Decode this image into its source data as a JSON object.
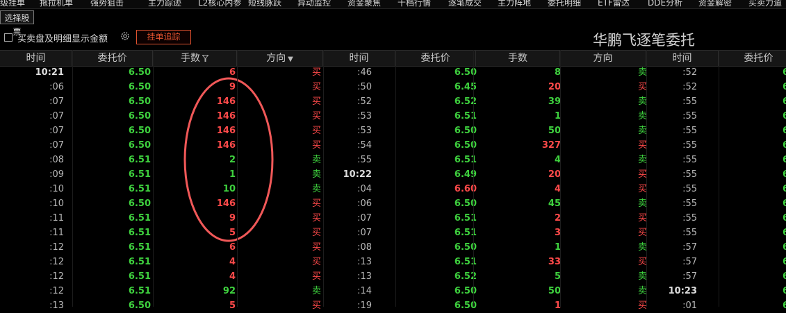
{
  "nav": {
    "tabs": [
      "级挂单",
      "拖拉机单",
      "强势狙击",
      "主力踪迹",
      "L2核心内参",
      "短线脉跃",
      "异动监控",
      "资金聚焦",
      "千档行情",
      "逐笔成交",
      "主力阵地",
      "委托明细",
      "ETF雷达",
      "DDE分析",
      "资金解密",
      "买卖力道"
    ]
  },
  "toolbar": {
    "select_stock_label": "选择股票",
    "show_amount_label": "买卖盘及明细显示金额",
    "show_amount_checked": false,
    "trace_label": "挂单追踪"
  },
  "panel_title": "华鹏飞逐笔委托",
  "columns": {
    "time": "时间",
    "price": "委托价",
    "qty": "手数",
    "dir": "方向"
  },
  "colors": {
    "up": "#ff4a4a",
    "down": "#3ed13e",
    "accent": "#e0522f",
    "annotation": "#ff5a5a"
  },
  "groups": [
    {
      "rows": [
        {
          "t": "10:21",
          "p": "6.50",
          "pc": "green",
          "q": "6",
          "d": "买"
        },
        {
          "t": ":06",
          "p": "6.50",
          "pc": "green",
          "q": "9",
          "d": "买"
        },
        {
          "t": ":07",
          "p": "6.50",
          "pc": "green",
          "q": "146",
          "d": "买"
        },
        {
          "t": ":07",
          "p": "6.50",
          "pc": "green",
          "q": "146",
          "d": "买"
        },
        {
          "t": ":07",
          "p": "6.50",
          "pc": "green",
          "q": "146",
          "d": "买"
        },
        {
          "t": ":07",
          "p": "6.50",
          "pc": "green",
          "q": "146",
          "d": "买"
        },
        {
          "t": ":08",
          "p": "6.51",
          "pc": "green",
          "q": "2",
          "d": "卖"
        },
        {
          "t": ":09",
          "p": "6.51",
          "pc": "green",
          "q": "1",
          "d": "卖"
        },
        {
          "t": ":10",
          "p": "6.51",
          "pc": "green",
          "q": "10",
          "d": "卖"
        },
        {
          "t": ":10",
          "p": "6.50",
          "pc": "green",
          "q": "146",
          "d": "买"
        },
        {
          "t": ":11",
          "p": "6.51",
          "pc": "green",
          "q": "9",
          "d": "买"
        },
        {
          "t": ":11",
          "p": "6.51",
          "pc": "green",
          "q": "5",
          "d": "买"
        },
        {
          "t": ":12",
          "p": "6.51",
          "pc": "green",
          "q": "6",
          "d": "买"
        },
        {
          "t": ":12",
          "p": "6.51",
          "pc": "green",
          "q": "4",
          "d": "买"
        },
        {
          "t": ":12",
          "p": "6.51",
          "pc": "green",
          "q": "4",
          "d": "买"
        },
        {
          "t": ":12",
          "p": "6.51",
          "pc": "green",
          "q": "92",
          "d": "卖"
        },
        {
          "t": ":13",
          "p": "6.50",
          "pc": "green",
          "q": "5",
          "d": "买"
        }
      ]
    },
    {
      "rows": [
        {
          "t": ":46",
          "p": "6.50",
          "pc": "green",
          "q": "8",
          "d": "卖"
        },
        {
          "t": ":50",
          "p": "6.45",
          "pc": "green",
          "q": "20",
          "d": "买"
        },
        {
          "t": ":52",
          "p": "6.52",
          "pc": "green",
          "q": "39",
          "d": "卖"
        },
        {
          "t": ":53",
          "p": "6.51",
          "pc": "green",
          "q": "1",
          "d": "卖"
        },
        {
          "t": ":53",
          "p": "6.50",
          "pc": "green",
          "q": "50",
          "d": "卖"
        },
        {
          "t": ":54",
          "p": "6.50",
          "pc": "green",
          "q": "327",
          "d": "买"
        },
        {
          "t": ":55",
          "p": "6.51",
          "pc": "green",
          "q": "4",
          "d": "卖"
        },
        {
          "t": "10:22",
          "p": "6.49",
          "pc": "green",
          "q": "20",
          "d": "买"
        },
        {
          "t": ":04",
          "p": "6.60",
          "pc": "red",
          "q": "4",
          "d": "买"
        },
        {
          "t": ":06",
          "p": "6.50",
          "pc": "green",
          "q": "45",
          "d": "卖"
        },
        {
          "t": ":07",
          "p": "6.51",
          "pc": "green",
          "q": "2",
          "d": "买"
        },
        {
          "t": ":07",
          "p": "6.51",
          "pc": "green",
          "q": "3",
          "d": "买"
        },
        {
          "t": ":08",
          "p": "6.50",
          "pc": "green",
          "q": "1",
          "d": "卖"
        },
        {
          "t": ":13",
          "p": "6.51",
          "pc": "green",
          "q": "33",
          "d": "买"
        },
        {
          "t": ":13",
          "p": "6.52",
          "pc": "green",
          "q": "5",
          "d": "卖"
        },
        {
          "t": ":14",
          "p": "6.50",
          "pc": "green",
          "q": "50",
          "d": "卖"
        },
        {
          "t": ":19",
          "p": "6.50",
          "pc": "green",
          "q": "1",
          "d": "买"
        }
      ]
    },
    {
      "rows": [
        {
          "t": ":52"
        },
        {
          "t": ":52"
        },
        {
          "t": ":55"
        },
        {
          "t": ":55"
        },
        {
          "t": ":55"
        },
        {
          "t": ":55"
        },
        {
          "t": ":55"
        },
        {
          "t": ":55"
        },
        {
          "t": ":55"
        },
        {
          "t": ":55"
        },
        {
          "t": ":55"
        },
        {
          "t": ":55"
        },
        {
          "t": ":57"
        },
        {
          "t": ":57"
        },
        {
          "t": ":57"
        },
        {
          "t": "10:23"
        },
        {
          "t": ":01"
        }
      ]
    }
  ]
}
